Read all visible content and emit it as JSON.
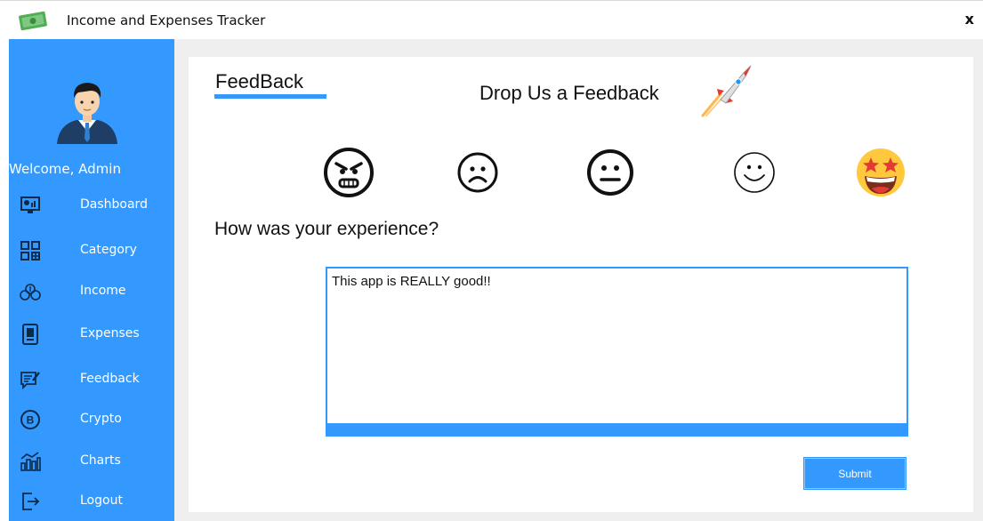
{
  "window": {
    "title": "Income and Expenses Tracker",
    "close_label": "x"
  },
  "sidebar": {
    "welcome": "Welcome, Admin",
    "items": [
      {
        "label": "Dashboard",
        "icon": "dashboard-icon"
      },
      {
        "label": "Category",
        "icon": "category-icon"
      },
      {
        "label": "Income",
        "icon": "income-icon"
      },
      {
        "label": "Expenses",
        "icon": "expenses-icon"
      },
      {
        "label": "Feedback",
        "icon": "feedback-icon"
      },
      {
        "label": "Crypto",
        "icon": "crypto-icon"
      },
      {
        "label": "Charts",
        "icon": "charts-icon"
      },
      {
        "label": "Logout",
        "icon": "logout-icon"
      }
    ]
  },
  "main": {
    "heading": "FeedBack",
    "subheading": "Drop Us a Feedback",
    "ratings": [
      "angry-face-icon",
      "sad-face-icon",
      "neutral-face-icon",
      "smile-face-icon",
      "star-struck-face-icon"
    ],
    "question": "How was your experience?",
    "feedback_text": "This app is REALLY good!!",
    "submit_label": "Submit"
  },
  "colors": {
    "accent": "#3399ff",
    "background": "#efefef"
  }
}
